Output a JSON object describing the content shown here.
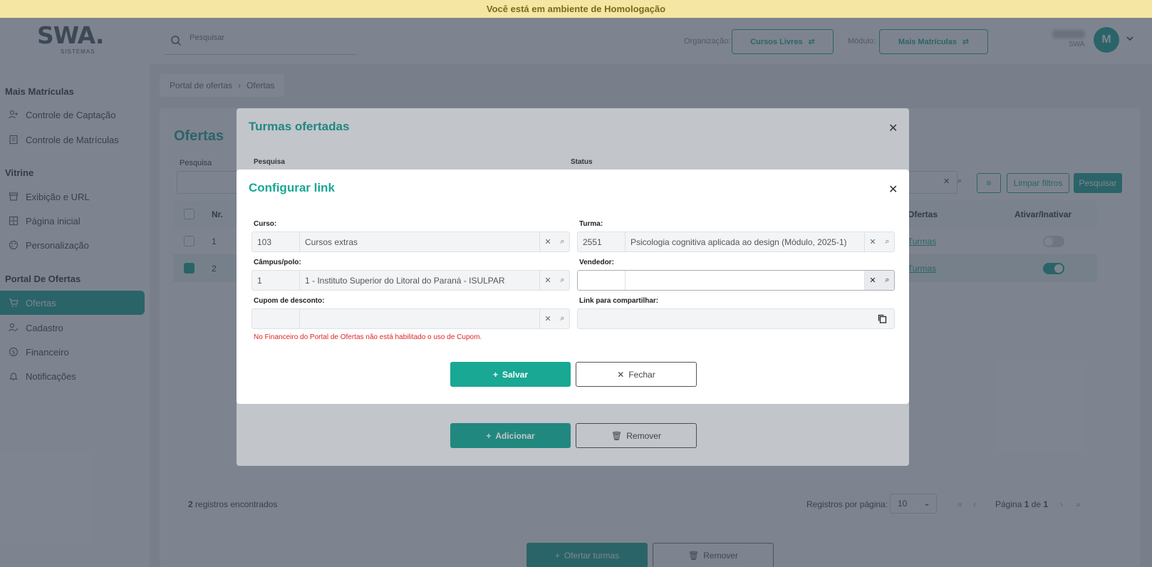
{
  "banner": "Você está em ambiente de Homologação",
  "logo": {
    "main": "SWA.",
    "sub": "SISTEMAS"
  },
  "top": {
    "search_placeholder": "Pesquisar",
    "org_label": "Organização:",
    "org_value": "Cursos Livres",
    "module_label": "Módulo:",
    "module_value": "Mais Matrículas",
    "user_sub": "SWA",
    "avatar_letter": "M"
  },
  "sidebar": {
    "sections": [
      {
        "title": "Mais Matrículas",
        "items": [
          {
            "label": "Controle de Captação",
            "icon": "user-plus-icon"
          },
          {
            "label": "Controle de Matrículas",
            "icon": "document-icon"
          }
        ]
      },
      {
        "title": "Vitrine",
        "items": [
          {
            "label": "Exibição e URL",
            "icon": "storefront-icon"
          },
          {
            "label": "Página inicial",
            "icon": "grid-icon"
          },
          {
            "label": "Personalização",
            "icon": "palette-icon"
          }
        ]
      },
      {
        "title": "Portal De Ofertas",
        "items": [
          {
            "label": "Ofertas",
            "icon": "cart-icon",
            "active": true
          },
          {
            "label": "Cadastro",
            "icon": "user-edit-icon"
          },
          {
            "label": "Financeiro",
            "icon": "dollar-icon"
          },
          {
            "label": "Notificações",
            "icon": "bell-icon"
          }
        ]
      }
    ]
  },
  "breadcrumb": {
    "root": "Portal de ofertas",
    "current": "Ofertas"
  },
  "page": {
    "title": "Ofertas",
    "search_label": "Pesquisa",
    "clear_filters": "Limpar filtros",
    "search_button": "Pesquisar",
    "columns": {
      "nr": "Nr.",
      "ofertas": "Ofertas",
      "toggle": "Ativar/Inativar"
    },
    "rows": [
      {
        "nr": "1",
        "link": "Turmas",
        "active": false,
        "selected": false
      },
      {
        "nr": "2",
        "link": "Turmas",
        "active": true,
        "selected": true
      }
    ],
    "records_count": "2",
    "records_text": "registros encontrados",
    "per_page_label": "Registros por página:",
    "per_page_value": "10",
    "pagination_prefix": "Página",
    "pagination_current": "1",
    "pagination_of": "de",
    "pagination_total": "1",
    "offer_button": "Ofertar turmas",
    "remove_button": "Remover"
  },
  "modal_turmas": {
    "title": "Turmas ofertadas",
    "search_label": "Pesquisa",
    "status_label": "Status",
    "add_button": "Adicionar",
    "remove_button": "Remover"
  },
  "modal_link": {
    "title": "Configurar link",
    "curso": {
      "label": "Curso:",
      "code": "103",
      "desc": "Cursos extras"
    },
    "turma": {
      "label": "Turma:",
      "code": "2551",
      "desc": "Psicologia cognitiva aplicada ao design (Módulo, 2025-1)"
    },
    "campus": {
      "label": "Câmpus/polo:",
      "code": "1",
      "desc": "1 - Instituto Superior do Litoral do Paraná - ISULPAR"
    },
    "vendedor": {
      "label": "Vendedor:",
      "code": "",
      "desc": ""
    },
    "cupom": {
      "label": "Cupom de desconto:",
      "code": "",
      "desc": ""
    },
    "link": {
      "label": "Link para compartilhar:",
      "value": ""
    },
    "error": "No Financeiro do Portal de Ofertas não está habilitado o uso de Cupom.",
    "save_button": "Salvar",
    "close_button": "Fechar"
  },
  "colors": {
    "accent": "#19a894",
    "banner": "#f5e6a3",
    "error": "#e02424"
  }
}
